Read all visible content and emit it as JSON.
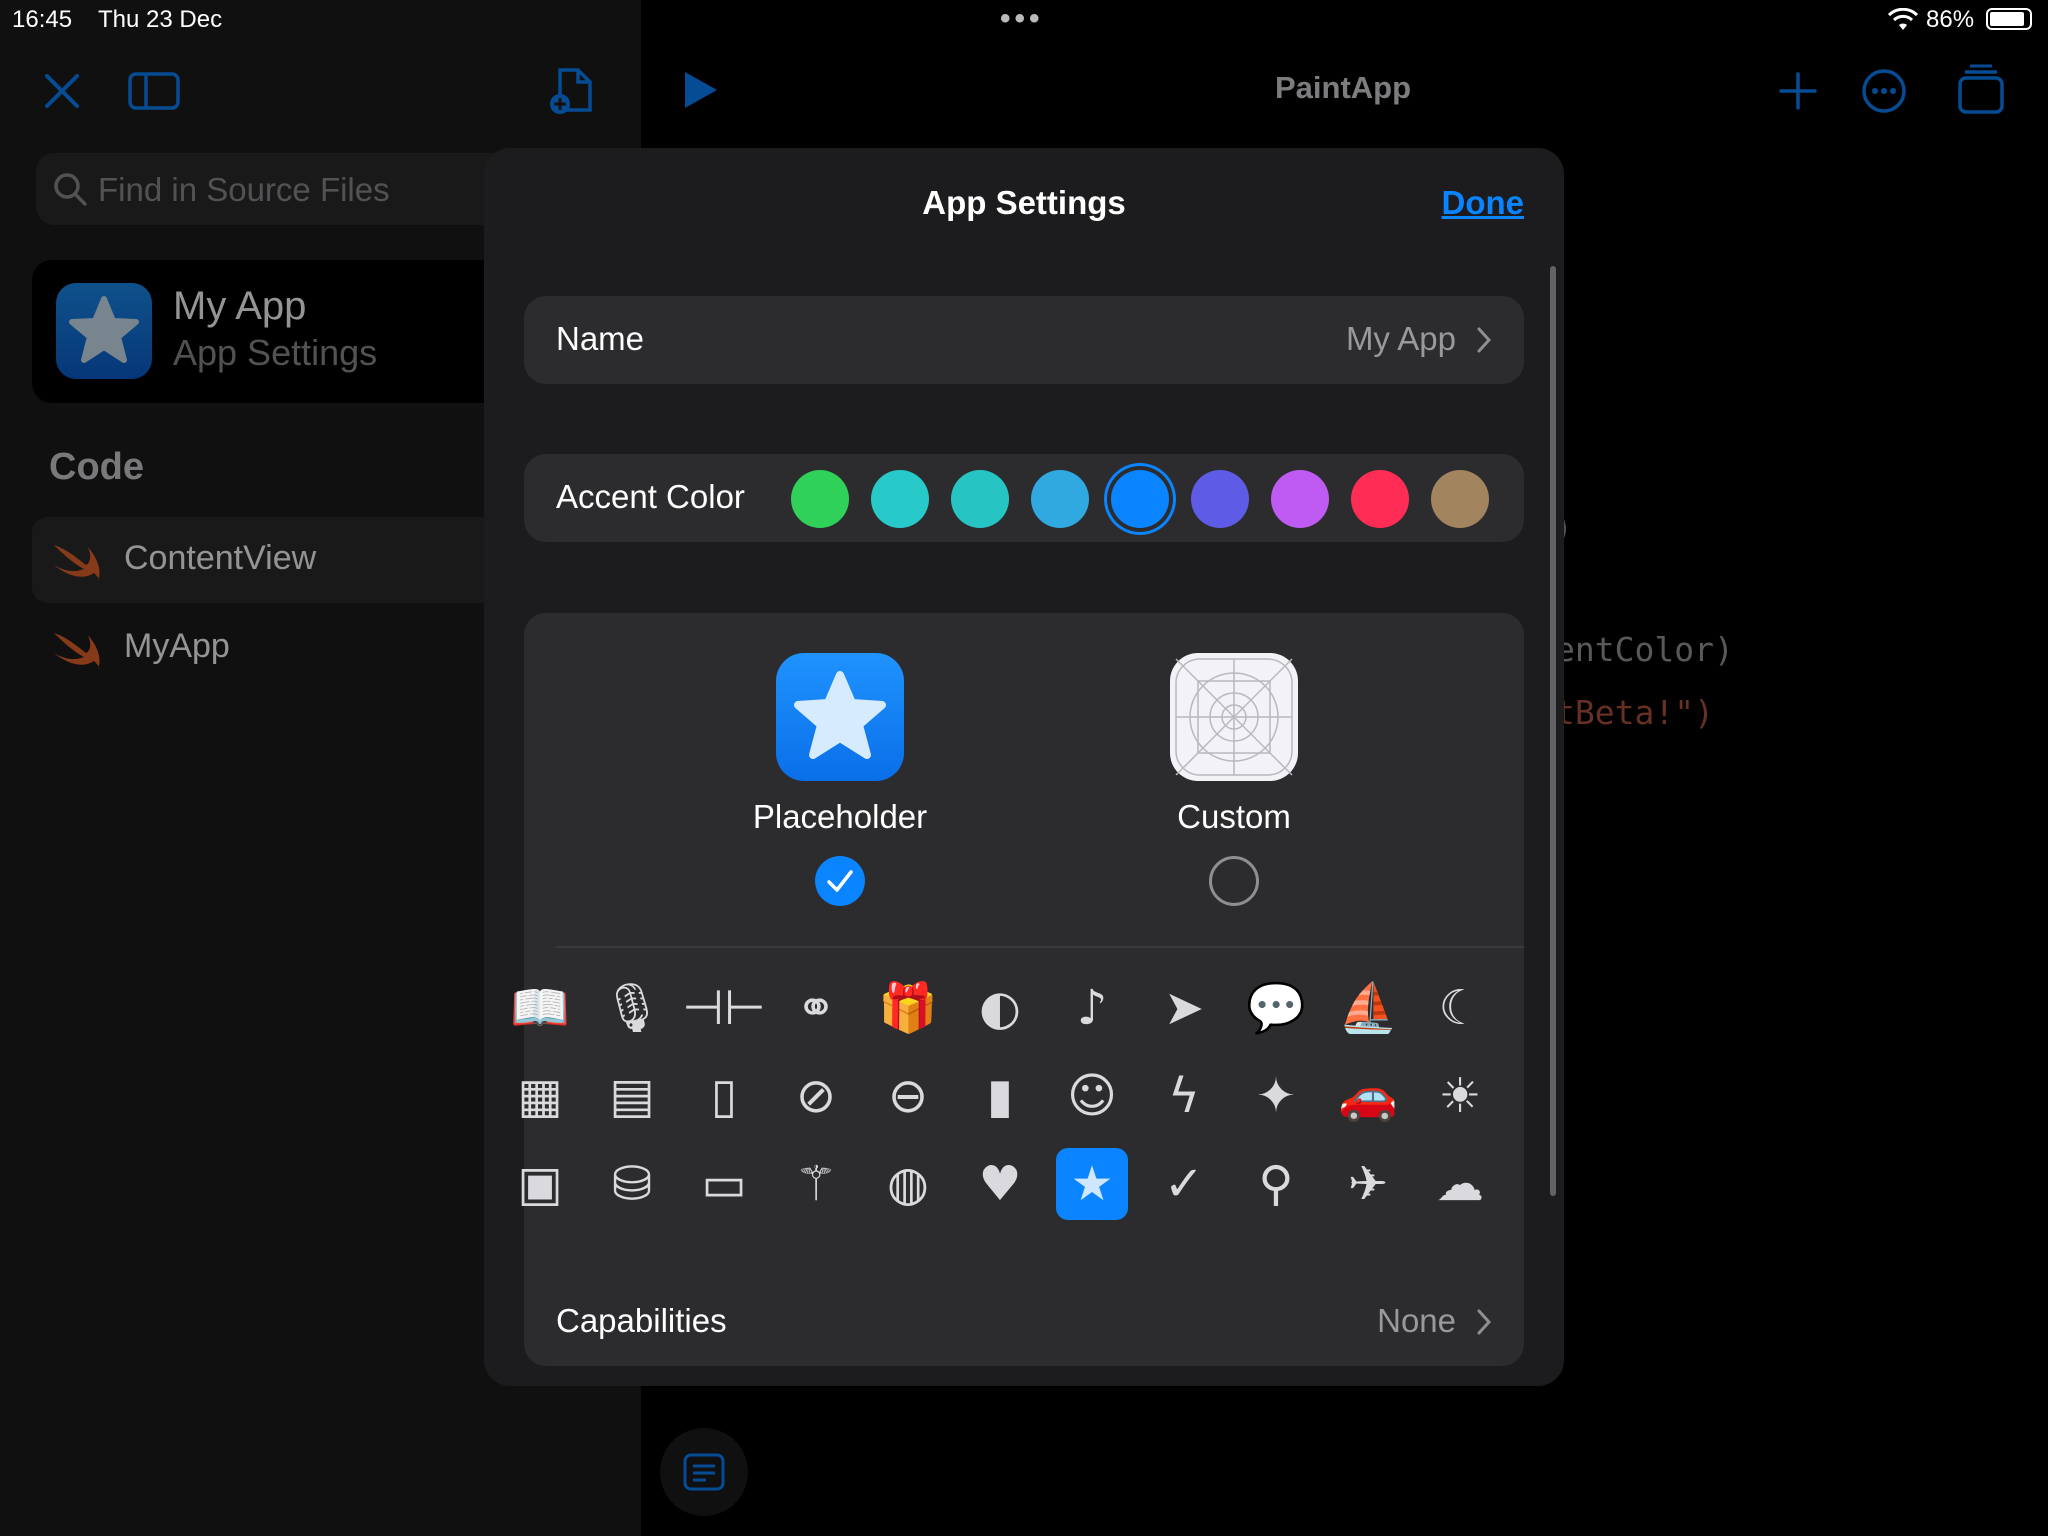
{
  "status_bar": {
    "time": "16:45",
    "date": "Thu 23 Dec",
    "battery": "86%"
  },
  "sidebar": {
    "search_placeholder": "Find in Source Files",
    "project": {
      "name": "My App",
      "subtitle": "App Settings"
    },
    "section_title": "Code",
    "files": [
      {
        "label": "ContentView"
      },
      {
        "label": "MyApp"
      }
    ]
  },
  "editor": {
    "title": "PaintApp",
    "code_fragments": [
      {
        "text": ")",
        "color": "#8e8e93"
      },
      {
        "text": "entColor)",
        "color": "#9a9a9f"
      },
      {
        "text": "tBeta!\")",
        "color": "#b0533c"
      }
    ]
  },
  "modal": {
    "title": "App Settings",
    "done_label": "Done",
    "name_row": {
      "label": "Name",
      "value": "My App"
    },
    "accent_row": {
      "label": "Accent Color",
      "colors": [
        "#30d158",
        "#27c9c9",
        "#27c4c4",
        "#30a8e0",
        "#0a84ff",
        "#5e5ce6",
        "#bf5af2",
        "#ff2d55",
        "#a2845e"
      ],
      "selected_index": 4
    },
    "icon_choices": [
      {
        "label": "Placeholder",
        "selected": true
      },
      {
        "label": "Custom",
        "selected": false
      }
    ],
    "glyphs": [
      [
        "book-icon",
        "microphone-icon",
        "dumbbell-icon",
        "binoculars-icon",
        "gift-icon",
        "beachball-icon",
        "music-note-icon",
        "location-arrow-icon",
        "speech-bubble-icon",
        "sailboat-icon",
        "moon-icon"
      ],
      [
        "calculator-icon",
        "archive-box-icon",
        "document-icon",
        "bandage-icon",
        "ufo-icon",
        "bar-chart-icon",
        "smiley-icon",
        "lightning-icon",
        "sparkles-icon",
        "car-icon",
        "sun-icon"
      ],
      [
        "photo-icon",
        "coins-icon",
        "monitor-icon",
        "magic-wand-icon",
        "globe-icon",
        "heart-icon",
        "star-icon",
        "checkmark-icon",
        "bicycle-icon",
        "airplane-icon",
        "cloud-icon"
      ]
    ],
    "selected_glyph": "star-icon",
    "capabilities_row": {
      "label": "Capabilities",
      "value": "None"
    }
  }
}
